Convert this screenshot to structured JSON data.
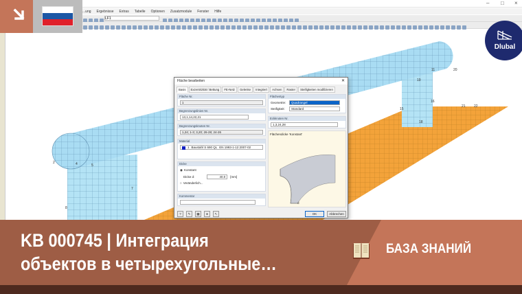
{
  "app": {
    "menu": [
      "...ung",
      "Ergebnisse",
      "Extras",
      "Tabelle",
      "Optionen",
      "Zusatzmodule",
      "Fenster",
      "Hilfe"
    ],
    "load_case": "LF1",
    "window_controls": [
      "–",
      "□",
      "×"
    ]
  },
  "model_labels": [
    "2",
    "4",
    "5",
    "7",
    "8",
    "11",
    "15",
    "16",
    "18",
    "19",
    "20",
    "21",
    "22"
  ],
  "dialog": {
    "title": "Fläche bearbeiten",
    "tabs": [
      "Basis",
      "Exzentrizität / Bettung",
      "FE-Netz",
      "Gelenke",
      "Integriert",
      "Achsen",
      "Raster",
      "Steifigkeiten modifizieren"
    ],
    "surface_no_label": "Fläche Nr.",
    "surface_no": "1",
    "boundary_lines_label": "Begrenzungslinien Nr.",
    "boundary_lines": "13,1,14,22,21",
    "boundary_nodes_label": "Begrenzungsknoten Nr.",
    "boundary_nodes": "1,24; 1-3; 3,20; 26-28; 24-26",
    "material_label": "Material",
    "material_no": "1",
    "material_name": "Baustahl S 690 QL",
    "material_norm": "EN 1993-1-12:2007-02",
    "thickness_label": "Dicke",
    "constant_label": "Konstant",
    "thickness_d_label": "Dicke d:",
    "thickness_value": "40.0",
    "thickness_unit": "[mm]",
    "variable_label": "Veränderlich...",
    "comment_label": "Kommentar",
    "surface_type_label": "Flächentyp",
    "geometry_label": "Geometrie:",
    "geometry_value": "Quadrangel",
    "stiffness_label": "Steifigkeit:",
    "stiffness_value": "Standard",
    "corner_nodes_label": "Eckknoten Nr.",
    "corner_nodes": "1,3,24,28",
    "preview_label": "Flächendicke 'Konstant'",
    "preview_dim": "d",
    "ok": "OK",
    "cancel": "Abbrechen"
  },
  "logo_text": "Dlubal",
  "banner": {
    "line1": "KB 000745 | Интеграция",
    "line2": "объектов в четырехугольные…",
    "category": "БАЗА ЗНАНИЙ"
  },
  "colors": {
    "orange": "#c47559",
    "brown": "#9e5d45",
    "dark": "#4e2a1f",
    "dlubal": "#1e2a6e",
    "mesh": "#a9dcf3",
    "slab": "#f3a33a"
  }
}
